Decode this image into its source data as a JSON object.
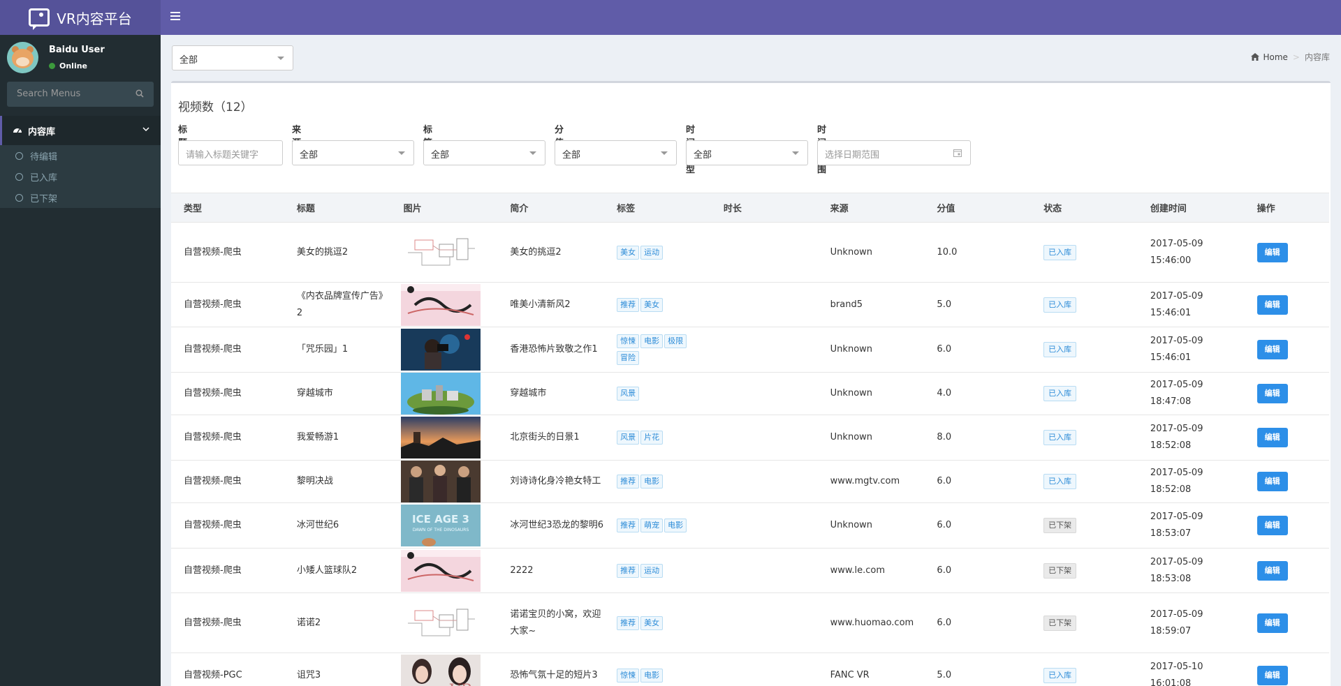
{
  "app": {
    "title": "VR内容平台"
  },
  "user": {
    "name": "Baidu User",
    "status": "Online"
  },
  "sidebar": {
    "search_placeholder": "Search Menus",
    "menu_title": "内容库",
    "items": [
      {
        "label": "待编辑"
      },
      {
        "label": "已入库"
      },
      {
        "label": "已下架"
      }
    ]
  },
  "top_select": {
    "value": "全部"
  },
  "breadcrumb": {
    "home": "Home",
    "current": "内容库"
  },
  "box": {
    "title": "视频数（12）"
  },
  "filters": {
    "title_label": "标题",
    "title_placeholder": "请输入标题关键字",
    "source_label": "来源",
    "source_value": "全部",
    "tag_label": "标签",
    "tag_value": "全部",
    "score_label": "分值",
    "score_value": "全部",
    "time_type_label": "时间类型",
    "time_type_value": "全部",
    "time_range_label": "时间范围",
    "time_range_placeholder": "选择日期范围"
  },
  "table": {
    "headers": [
      "类型",
      "标题",
      "图片",
      "简介",
      "标签",
      "时长",
      "来源",
      "分值",
      "状态",
      "创建时间",
      "操作"
    ],
    "edit_label": "编辑",
    "rows": [
      {
        "type": "自营视频-爬虫",
        "title": "美女的挑逗2",
        "image": "diagram",
        "intro": "美女的挑逗2",
        "tags": [
          "美女",
          "运动"
        ],
        "duration": "",
        "source": "Unknown",
        "score": "10.0",
        "status": "已入库",
        "created": "2017-05-09 15:46:00",
        "h": 86
      },
      {
        "type": "自营视频-爬虫",
        "title": "《内衣品牌宣传广告》2",
        "image": "pink",
        "intro": "唯美小清新风2",
        "tags": [
          "推荐",
          "美女"
        ],
        "duration": "",
        "source": "brand5",
        "score": "5.0",
        "status": "已入库",
        "created": "2017-05-09 15:46:01",
        "h": 64
      },
      {
        "type": "自营视频-爬虫",
        "title": "「咒乐园」1",
        "image": "blue-man",
        "intro": "香港恐怖片致敬之作1",
        "tags": [
          "惊悚",
          "电影",
          "极限",
          "冒险"
        ],
        "duration": "",
        "source": "Unknown",
        "score": "6.0",
        "status": "已入库",
        "created": "2017-05-09 15:46:01",
        "h": 65
      },
      {
        "type": "自营视频-爬虫",
        "title": "穿越城市",
        "image": "island",
        "intro": "穿越城市",
        "tags": [
          "风景"
        ],
        "duration": "",
        "source": "Unknown",
        "score": "4.0",
        "status": "已入库",
        "created": "2017-05-09 18:47:08",
        "h": 48
      },
      {
        "type": "自营视频-爬虫",
        "title": "我爱畅游1",
        "image": "sunset",
        "intro": "北京街头的日景1",
        "tags": [
          "风景",
          "片花"
        ],
        "duration": "",
        "source": "Unknown",
        "score": "8.0",
        "status": "已入库",
        "created": "2017-05-09 18:52:08",
        "h": 65
      },
      {
        "type": "自营视频-爬虫",
        "title": "黎明决战",
        "image": "people",
        "intro": "刘诗诗化身冷艳女特工",
        "tags": [
          "推荐",
          "电影"
        ],
        "duration": "",
        "source": "www.mgtv.com",
        "score": "6.0",
        "status": "已入库",
        "created": "2017-05-09 18:52:08",
        "h": 48
      },
      {
        "type": "自营视频-爬虫",
        "title": "冰河世纪6",
        "image": "iceage",
        "intro": "冰河世纪3恐龙的黎明6",
        "tags": [
          "推荐",
          "萌宠",
          "电影"
        ],
        "duration": "",
        "source": "Unknown",
        "score": "6.0",
        "status": "已下架",
        "created": "2017-05-09 18:53:07",
        "h": 65
      },
      {
        "type": "自营视频-爬虫",
        "title": "小矮人篮球队2",
        "image": "pink",
        "intro": "2222",
        "tags": [
          "推荐",
          "运动"
        ],
        "duration": "",
        "source": "www.le.com",
        "score": "6.0",
        "status": "已下架",
        "created": "2017-05-09 18:53:08",
        "h": 64
      },
      {
        "type": "自营视频-爬虫",
        "title": "诺诺2",
        "image": "diagram",
        "intro": "诺诺宝贝的小窝，欢迎大家~",
        "tags": [
          "推荐",
          "美女"
        ],
        "duration": "",
        "source": "www.huomao.com",
        "score": "6.0",
        "status": "已下架",
        "created": "2017-05-09 18:59:07",
        "h": 86
      },
      {
        "type": "自营视频-PGC",
        "title": "诅咒3",
        "image": "vr-girl",
        "intro": "恐怖气氛十足的短片3",
        "tags": [
          "惊悚",
          "电影"
        ],
        "duration": "",
        "source": "FANC VR",
        "score": "5.0",
        "status": "已入库",
        "created": "2017-05-10 16:01:08",
        "h": 65
      }
    ]
  },
  "colors": {
    "topbar": "#605ca8",
    "sidebar": "#222d32",
    "primary": "#2d8fe8"
  },
  "icons": [
    "logo-icon",
    "menu-toggle-icon",
    "search-icon",
    "dashboard-icon",
    "chevron-down-icon",
    "circle-icon",
    "home-icon",
    "calendar-icon",
    "caret-down-icon"
  ]
}
